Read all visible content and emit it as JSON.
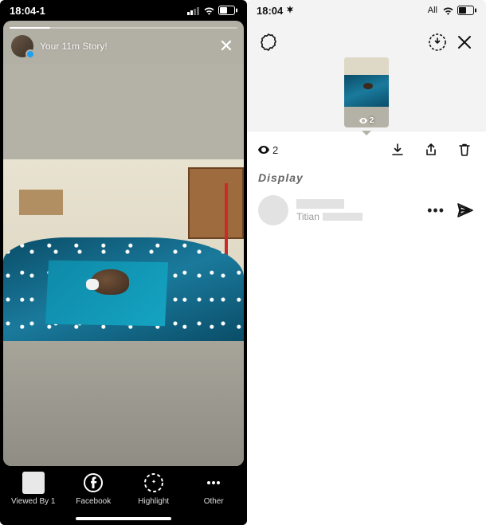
{
  "left": {
    "status": {
      "time": "18:04-1"
    },
    "story": {
      "title": "Your 11m Story!",
      "close_glyph": "✕"
    },
    "footer": {
      "viewed_by_count_label": "Viewed By 1",
      "facebook_label": "Facebook",
      "highlight_label": "Highlight",
      "other_label": "Other"
    }
  },
  "right": {
    "status": {
      "time": "18:04",
      "network_label": "All"
    },
    "thumb": {
      "view_count": "2"
    },
    "actions": {
      "view_count": "2"
    },
    "section_label": "Display",
    "viewer": {
      "subname": "Titian"
    }
  },
  "icons": {
    "eye": "eye-icon",
    "download": "download-icon",
    "share": "share-icon",
    "trash": "trash-icon",
    "settings": "settings-icon",
    "saved": "saved-icon",
    "close": "close-icon",
    "facebook": "facebook-icon",
    "highlight": "highlight-icon",
    "more": "more-icon",
    "send": "send-icon"
  }
}
